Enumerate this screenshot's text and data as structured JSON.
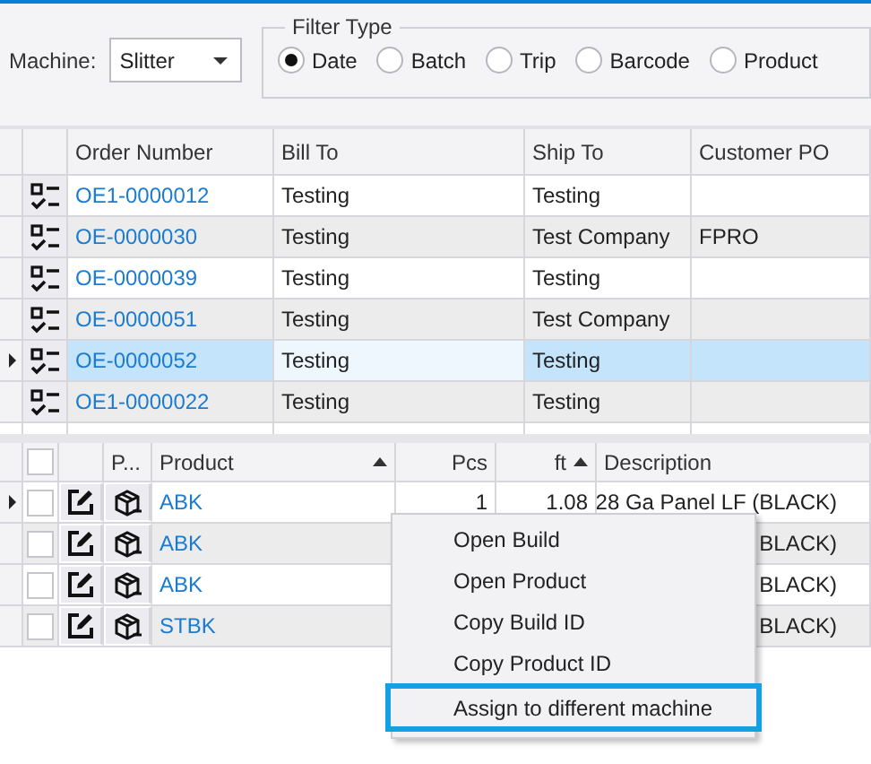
{
  "machine": {
    "label": "Machine:",
    "value": "Slitter"
  },
  "filter_type": {
    "title": "Filter Type",
    "options": [
      {
        "label": "Date",
        "selected": true
      },
      {
        "label": "Batch",
        "selected": false
      },
      {
        "label": "Trip",
        "selected": false
      },
      {
        "label": "Barcode",
        "selected": false
      },
      {
        "label": "Product",
        "selected": false
      }
    ]
  },
  "orders": {
    "columns": [
      "Order Number",
      "Bill To",
      "Ship To",
      "Customer PO"
    ],
    "rows": [
      {
        "current": false,
        "selected": false,
        "order_number": "OE1-0000012",
        "bill_to": "Testing",
        "ship_to": "Testing"
      },
      {
        "current": false,
        "selected": false,
        "order_number": "OE-0000030",
        "bill_to": "Testing",
        "ship_to": "Test Company",
        "customer_po": "FPRO"
      },
      {
        "current": false,
        "selected": false,
        "order_number": "OE-0000039",
        "bill_to": "Testing",
        "ship_to": "Testing"
      },
      {
        "current": false,
        "selected": false,
        "order_number": "OE-0000051",
        "bill_to": "Testing",
        "ship_to": "Test Company"
      },
      {
        "current": true,
        "selected": true,
        "order_number": "OE-0000052",
        "bill_to": "Testing",
        "ship_to": "Testing"
      },
      {
        "current": false,
        "selected": false,
        "order_number": "OE1-0000022",
        "bill_to": "Testing",
        "ship_to": "Testing"
      }
    ]
  },
  "builds": {
    "select_all": {
      "checked": false
    },
    "columns": [
      {
        "label": "P...",
        "sorted": false
      },
      {
        "label": "Product",
        "sorted": true
      },
      {
        "label": "Pcs",
        "sorted": false
      },
      {
        "label": "ft",
        "sorted": true
      },
      {
        "label": "Description",
        "sorted": false
      }
    ],
    "rows": [
      {
        "current": true,
        "checked": false,
        "product": "ABK",
        "pcs": "1",
        "ft": "1.08",
        "description": "28 Ga Panel LF (BLACK)"
      },
      {
        "current": false,
        "checked": false,
        "product": "ABK",
        "description": "BLACK)"
      },
      {
        "current": false,
        "checked": false,
        "product": "ABK",
        "description": "BLACK)"
      },
      {
        "current": false,
        "checked": false,
        "product": "STBK",
        "description": "BLACK)"
      }
    ]
  },
  "context_menu": {
    "items": [
      {
        "label": "Open Build",
        "highlighted": false
      },
      {
        "label": "Open Product",
        "highlighted": false
      },
      {
        "label": "Copy Build ID",
        "highlighted": false
      },
      {
        "label": "Copy Product ID",
        "highlighted": false
      },
      {
        "label": "Assign to different machine",
        "highlighted": true
      }
    ]
  }
}
